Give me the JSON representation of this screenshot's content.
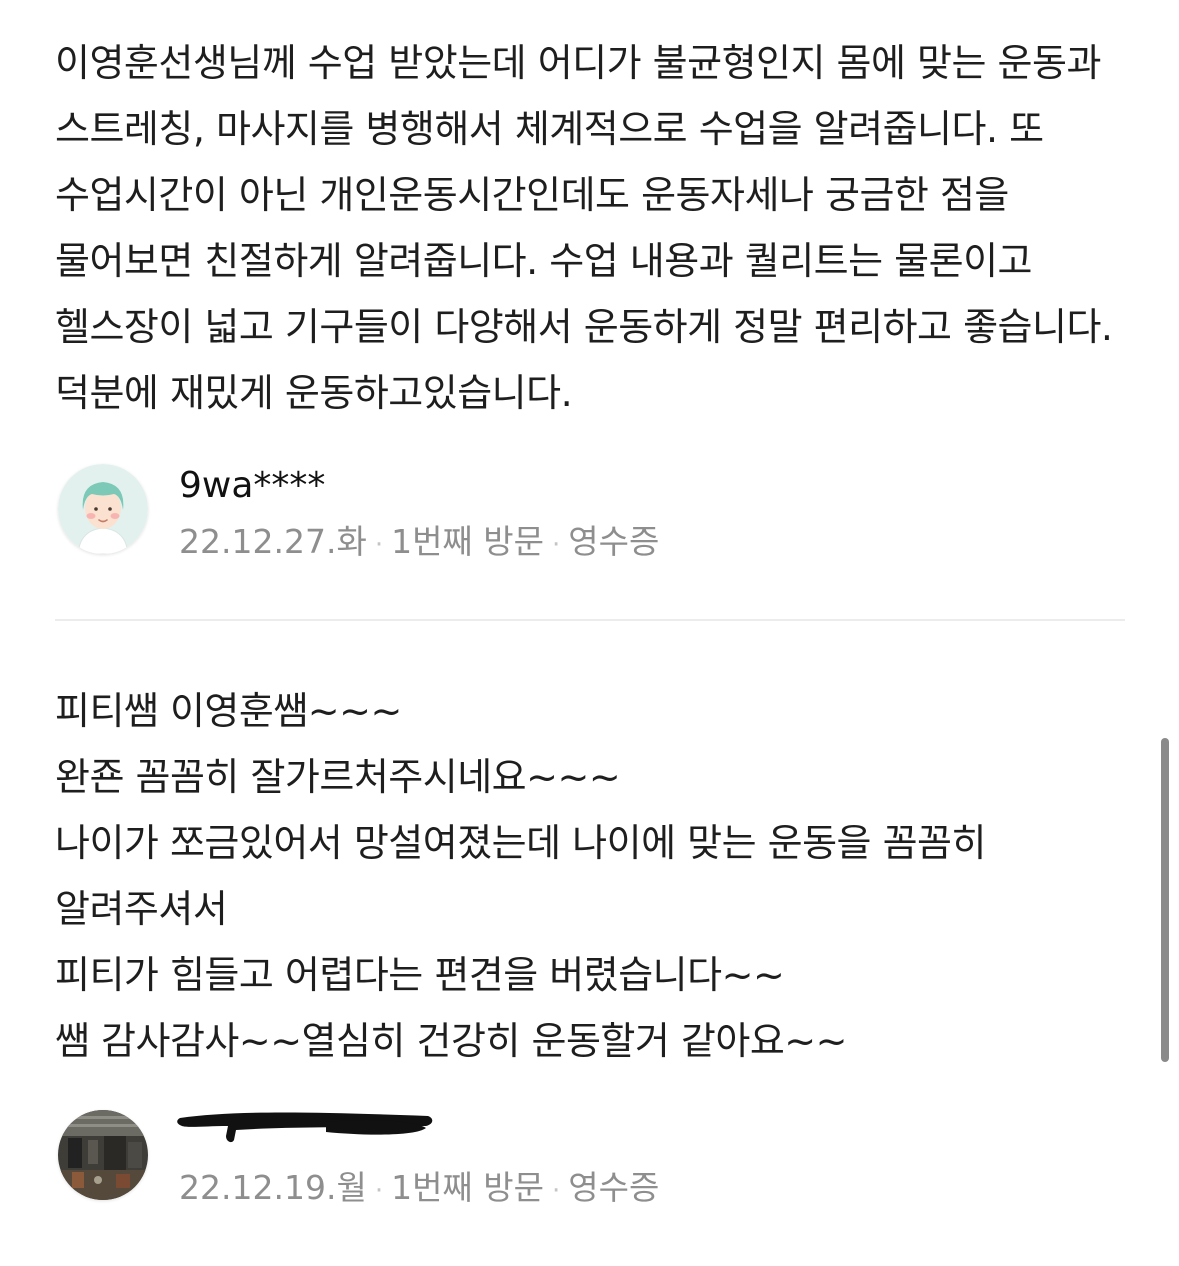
{
  "reviews": [
    {
      "text": "이영훈선생님께 수업 받았는데 어디가 불균형인지 몸에 맞는 운동과 스트레칭, 마사지를 병행해서 체계적으로 수업을 알려줍니다. 또 수업시간이 아닌 개인운동시간인데도 운동자세나 궁금한 점을 물어보면 친절하게 알려줍니다. 수업 내용과 퀄리트는 물론이고 헬스장이 넓고 기구들이 다양해서 운동하게 정말 편리하고 좋습니다. 덕분에 재밌게 운동하고있습니다.",
      "author": "9wa****",
      "date": "22.12.27.화",
      "visit": "1번째 방문",
      "verification": "영수증",
      "avatar_icon": "default-profile-icon"
    },
    {
      "text": "피티쌤 이영훈쌤~~~\n완죤 꼼꼼히 잘가르처주시네요~~~\n나이가 쪼금있어서 망설여졌는데 나이에 맞는 운동을 꼼꼼히 알려주셔서\n피티가 힘들고 어렵다는 편견을 버렸습니다~~\n쌤 감사감사~~열심히 건강히 운동할거 같아요~~",
      "author_redacted": true,
      "date": "22.12.19.월",
      "visit": "1번째 방문",
      "verification": "영수증",
      "avatar_icon": "photo-avatar-icon"
    }
  ],
  "colors": {
    "text": "#1e1e1e",
    "meta": "#8e8e8e",
    "divider": "#ececec",
    "scrollbar": "#8a8a8a"
  }
}
